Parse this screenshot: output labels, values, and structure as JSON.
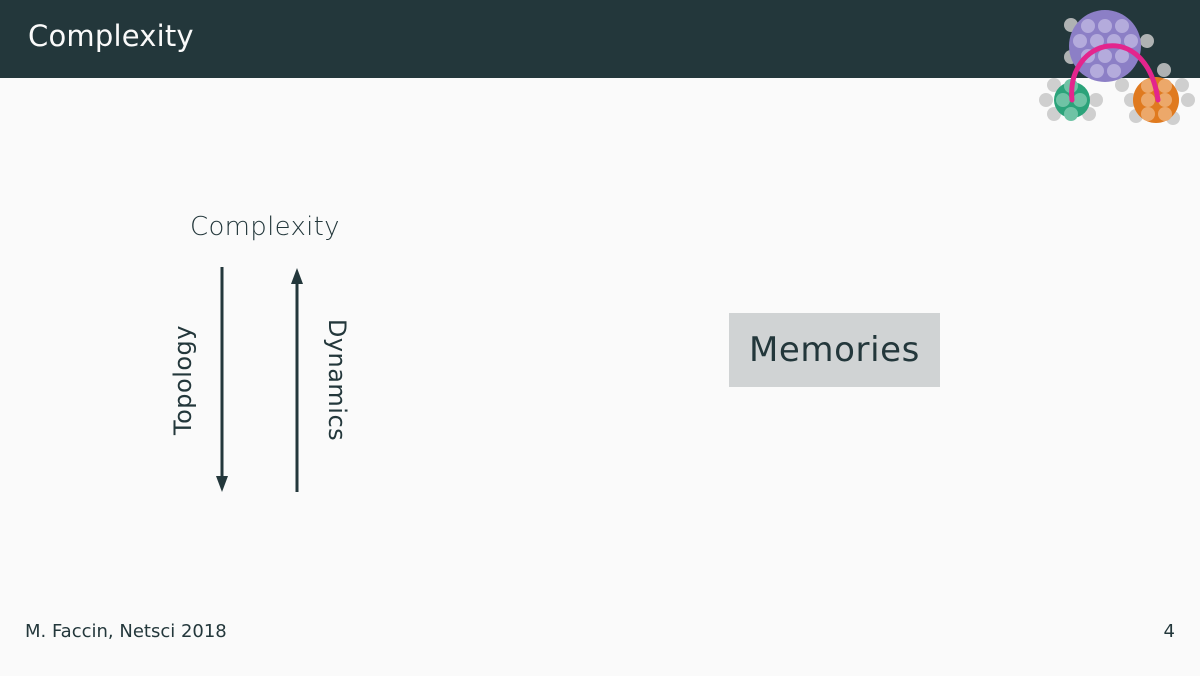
{
  "header": {
    "title": "Complexity"
  },
  "logo": {
    "name": "network-logo",
    "colors": {
      "purple": "#8c7fc6",
      "green": "#2ba37a",
      "orange": "#e07a1f",
      "link": "#e3258d",
      "grey": "#c8c8c8"
    }
  },
  "diagram": {
    "title": "Complexity",
    "down_arrow_label": "Topology",
    "up_arrow_label": "Dynamics"
  },
  "memories": {
    "label": "Memories"
  },
  "footer": {
    "citation": "M. Faccin, Netsci 2018",
    "page_number": "4"
  }
}
